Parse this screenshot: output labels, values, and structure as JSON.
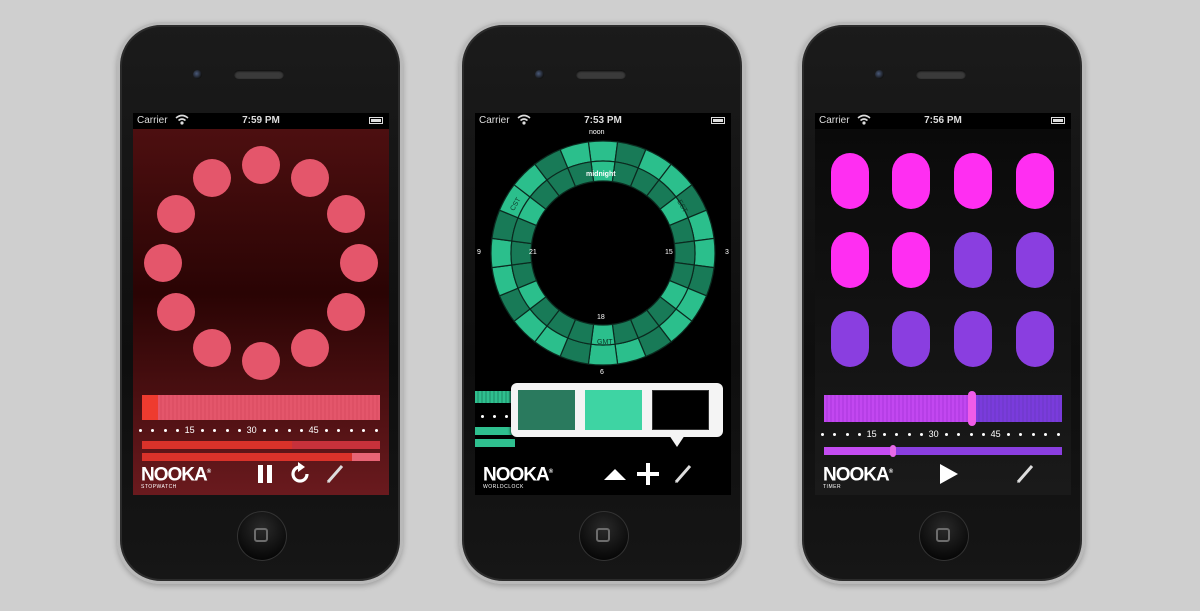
{
  "status": {
    "carrier": "Carrier"
  },
  "phones": [
    {
      "time": "7:59 PM",
      "app": "stopwatch",
      "logo": "NOOKA",
      "logo_sub": "STOPWATCH",
      "ticks": [
        "15",
        "30",
        "45"
      ],
      "controls": [
        "pause-icon",
        "reset-icon",
        "edit-icon"
      ],
      "colors": {
        "dots": "#e4566b",
        "bar": "#d9322a"
      }
    },
    {
      "time": "7:53 PM",
      "app": "worldclock",
      "logo": "NOOKA",
      "logo_sub": "WORLDCLOCK",
      "dial": {
        "outer_top": "noon",
        "inner_top": "midnight",
        "outer_left": "9",
        "outer_right": "3",
        "outer_bottom": "6",
        "inner_left": "21",
        "inner_right": "15",
        "inner_bottom": "18",
        "zone_labels": [
          "CST",
          "GMT",
          "EST"
        ]
      },
      "swatches": [
        "#2a7a5e",
        "#3ed4a3",
        "#000000"
      ],
      "controls": [
        "up-arrow-icon",
        "plus-icon",
        "edit-icon"
      ],
      "colors": {
        "ring": "#2bbf8c",
        "ring_dark": "#187a57"
      }
    },
    {
      "time": "7:56 PM",
      "app": "timer",
      "logo": "NOOKA",
      "logo_sub": "TIMER",
      "ticks": [
        "15",
        "30",
        "45"
      ],
      "pills_lit": 6,
      "pills_total": 12,
      "timer_progress": 0.62,
      "thin_progress": 0.29,
      "controls": [
        "play-icon",
        "edit-icon"
      ],
      "colors": {
        "lit": "#ff2ef2",
        "unlit": "#8a3ee0"
      }
    }
  ]
}
